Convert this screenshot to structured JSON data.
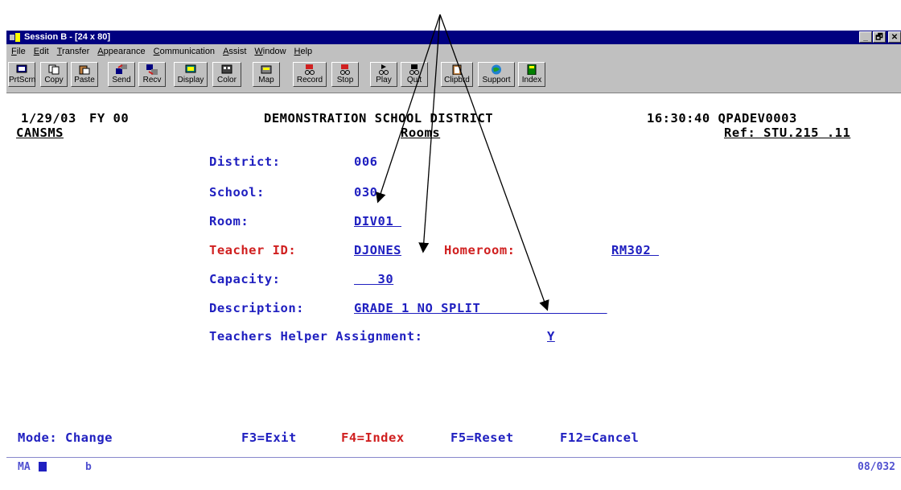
{
  "window": {
    "title": "Session B - [24 x 80]",
    "controls": [
      "_",
      "🗗",
      "✕"
    ]
  },
  "menu": [
    "File",
    "Edit",
    "Transfer",
    "Appearance",
    "Communication",
    "Assist",
    "Window",
    "Help"
  ],
  "toolbar": [
    {
      "label": "PrtScrn",
      "icon": "print-screen-icon"
    },
    {
      "label": "Copy",
      "icon": "copy-icon"
    },
    {
      "label": "Paste",
      "icon": "paste-icon"
    },
    {
      "label": "Send",
      "icon": "send-icon"
    },
    {
      "label": "Recv",
      "icon": "receive-icon"
    },
    {
      "label": "Display",
      "icon": "display-icon"
    },
    {
      "label": "Color",
      "icon": "color-icon"
    },
    {
      "label": "Map",
      "icon": "map-icon"
    },
    {
      "label": "Record",
      "icon": "record-icon"
    },
    {
      "label": "Stop",
      "icon": "stop-icon"
    },
    {
      "label": "Play",
      "icon": "play-icon"
    },
    {
      "label": "Quit",
      "icon": "quit-icon"
    },
    {
      "label": "Clipbrd",
      "icon": "clipboard-icon"
    },
    {
      "label": "Support",
      "icon": "support-icon"
    },
    {
      "label": "Index",
      "icon": "index-icon"
    }
  ],
  "screen": {
    "date": "1/29/03",
    "fy": "FY 00",
    "district_name": "DEMONSTRATION SCHOOL DISTRICT",
    "time_program": "16:30:40 QPADEV0003",
    "app_code": "CANSMS",
    "screen_title": "Rooms",
    "ref": "Ref: STU.215 .11",
    "fields": {
      "district_label": "District:",
      "district_value": "006",
      "school_label": "School:",
      "school_value": "030",
      "room_label": "Room:",
      "room_value": "DIV01 ",
      "teacher_label": "Teacher ID:",
      "teacher_value": "DJONES",
      "homeroom_label": "Homeroom:",
      "homeroom_value": "RM302 ",
      "capacity_label": "Capacity:",
      "capacity_value": "   30",
      "description_label": "Description:",
      "description_value": "GRADE 1 NO SPLIT                ",
      "helper_label": "Teachers Helper Assignment:",
      "helper_value": "Y"
    },
    "mode": "Mode: Change",
    "fkeys": {
      "f3": "F3=Exit",
      "f4": "F4=Index",
      "f5": "F5=Reset",
      "f12": "F12=Cancel"
    },
    "status_left": "MA",
    "status_mid": "b",
    "status_right": "08/032"
  },
  "colors": {
    "titlebar": "#000080",
    "field_blue": "#2020c0",
    "field_red": "#d02020"
  }
}
